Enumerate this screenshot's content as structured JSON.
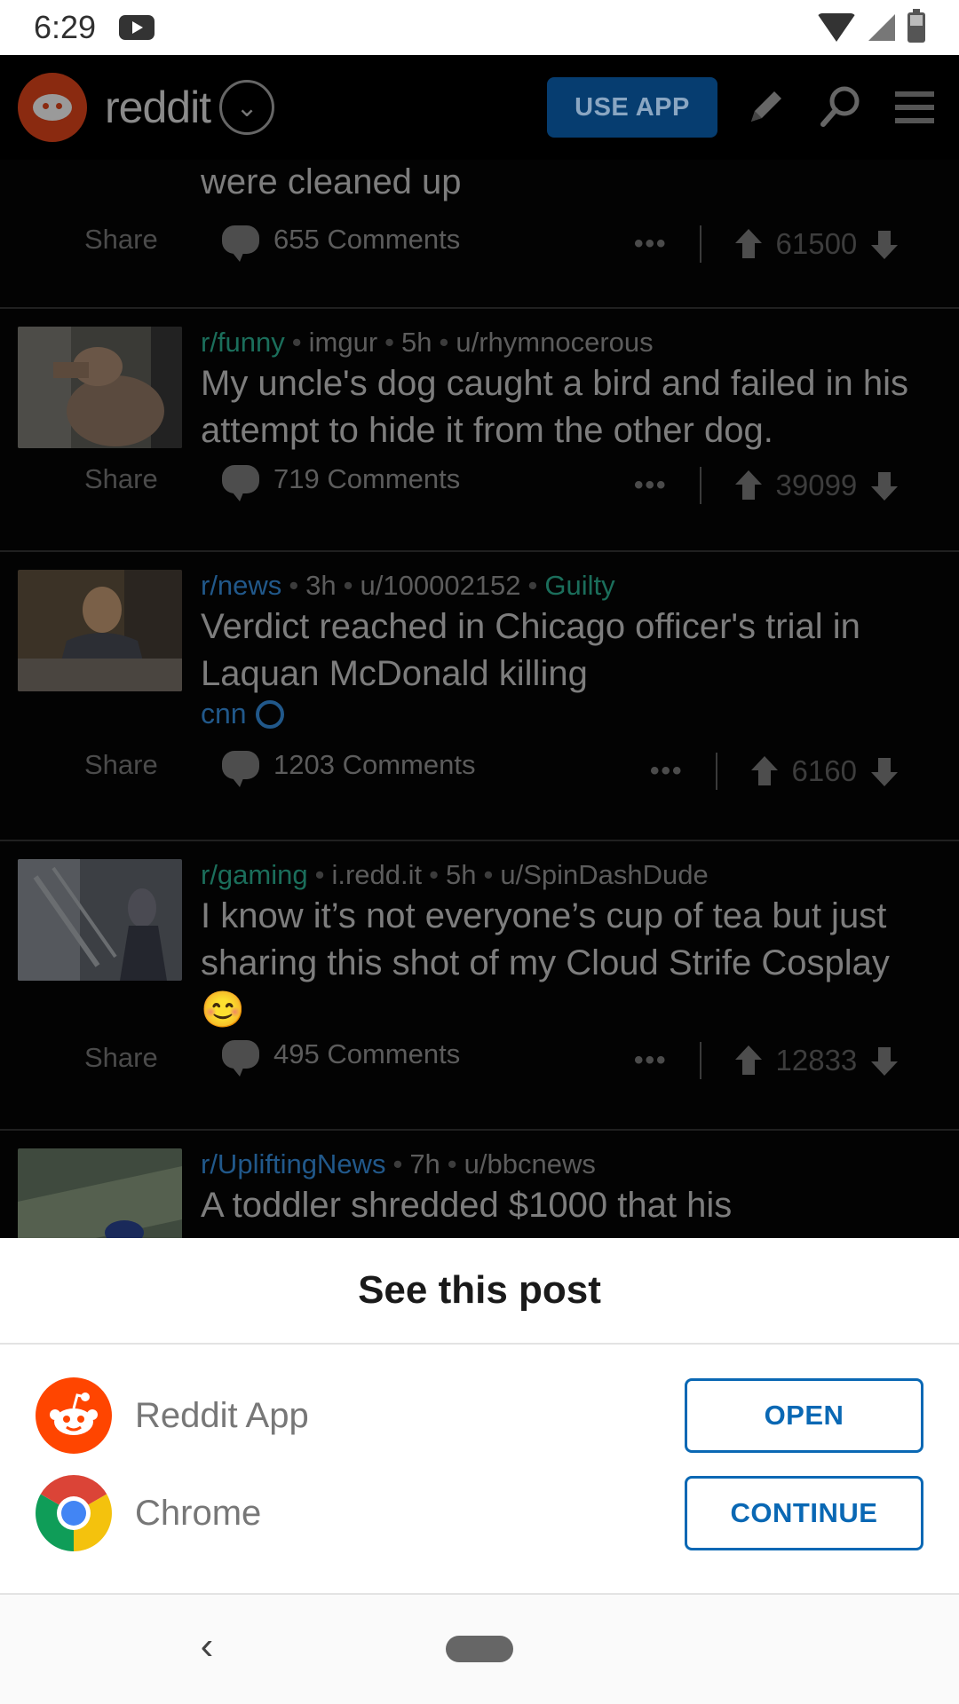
{
  "status_bar": {
    "time": "6:29"
  },
  "header": {
    "brand": "reddit",
    "use_app_label": "USE APP"
  },
  "feed": {
    "top_fragment": {
      "title": "were cleaned up",
      "share": "Share",
      "comments": "655 Comments",
      "score": "61500"
    },
    "posts": [
      {
        "subreddit": "r/funny",
        "domain": "imgur",
        "age": "5h",
        "author": "u/rhymnocerous",
        "title": "My uncle's dog caught a bird and failed in his attempt to hide it from the other dog.",
        "share": "Share",
        "comments": "719 Comments",
        "score": "39099"
      },
      {
        "subreddit": "r/news",
        "age": "3h",
        "author": "u/100002152",
        "flair": "Guilty",
        "title": "Verdict reached in Chicago officer's trial in Laquan McDonald killing",
        "link_domain": "cnn",
        "share": "Share",
        "comments": "1203 Comments",
        "score": "6160"
      },
      {
        "subreddit": "r/gaming",
        "domain": "i.redd.it",
        "age": "5h",
        "author": "u/SpinDashDude",
        "title": "I know it’s not everyone’s cup of tea but just sharing this shot of my Cloud Strife Cosplay 😊",
        "share": "Share",
        "comments": "495 Comments",
        "score": "12833"
      },
      {
        "subreddit": "r/UpliftingNews",
        "age": "7h",
        "author": "u/bbcnews",
        "title": "A toddler shredded $1000 that his"
      }
    ]
  },
  "sheet": {
    "title": "See this post",
    "options": [
      {
        "app": "Reddit App",
        "button": "OPEN"
      },
      {
        "app": "Chrome",
        "button": "CONTINUE"
      }
    ]
  },
  "colors": {
    "reddit_orange": "#ff4500",
    "link_blue": "#0a68b4"
  }
}
